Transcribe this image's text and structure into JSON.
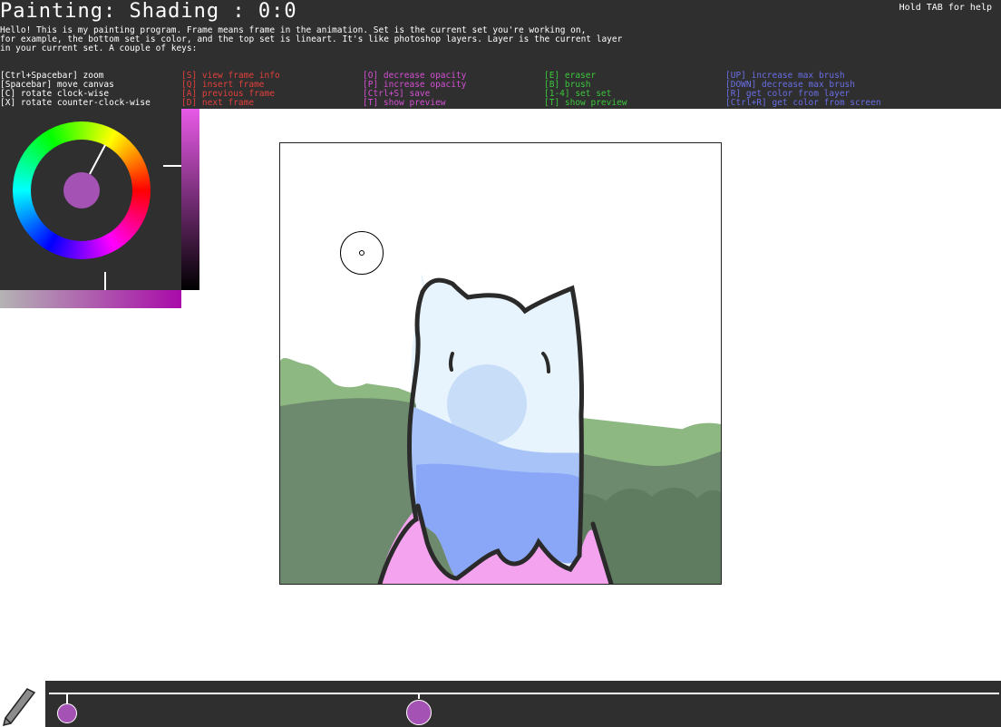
{
  "header": {
    "title": "Painting: Shading : 0:0",
    "help_hint": "Hold TAB for help",
    "intro_line1": "Hello! This is my painting program. Frame means frame in the animation. Set is the current set you're working on,",
    "intro_line2": "for example, the bottom set is color, and the top set is lineart. It's like photoshop layers. Layer is the current layer",
    "intro_line3": "in your current set. A couple of keys:"
  },
  "shortcuts": {
    "col0": [
      "[Ctrl+Spacebar] zoom",
      "[Spacebar] move canvas",
      "[C] rotate clock-wise",
      "[X] rotate counter-clock-wise"
    ],
    "col1": [
      "[S] view frame info",
      "[Q] insert frame",
      "[A] previous frame",
      "[D] next frame"
    ],
    "col2": [
      "[O] decrease opacity",
      "[P] increase opacity",
      "[Ctrl+S] save",
      "[T] show preview"
    ],
    "col3": [
      "[E] eraser",
      "[B] brush",
      "[1-4] set set",
      "[T] show preview"
    ],
    "col4": [
      "[UP] increase max brush",
      "[DOWN] decrease max brush",
      "[R] get color from layer",
      "[Ctrl+R] get color from screen"
    ]
  },
  "colors": {
    "current_color": "#a552b5",
    "panel_bg": "#2f2f2f",
    "shortcut_white": "#ffffff",
    "shortcut_red": "#e2403c",
    "shortcut_magenta": "#d54fd5",
    "shortcut_green": "#3bc83b",
    "shortcut_blue": "#6a6ee6"
  },
  "color_picker": {
    "hue_indicator_icon": "hue-needle-icon",
    "value_bar_top": "#e85ae8",
    "value_bar_bottom": "#000000",
    "saturation_bar_left": "#b4b4b4",
    "saturation_bar_right": "#a90aa9"
  },
  "tool": {
    "icon": "pencil-icon"
  },
  "timeline": {
    "frame_markers": 2,
    "knob_color": "#a552b5"
  }
}
